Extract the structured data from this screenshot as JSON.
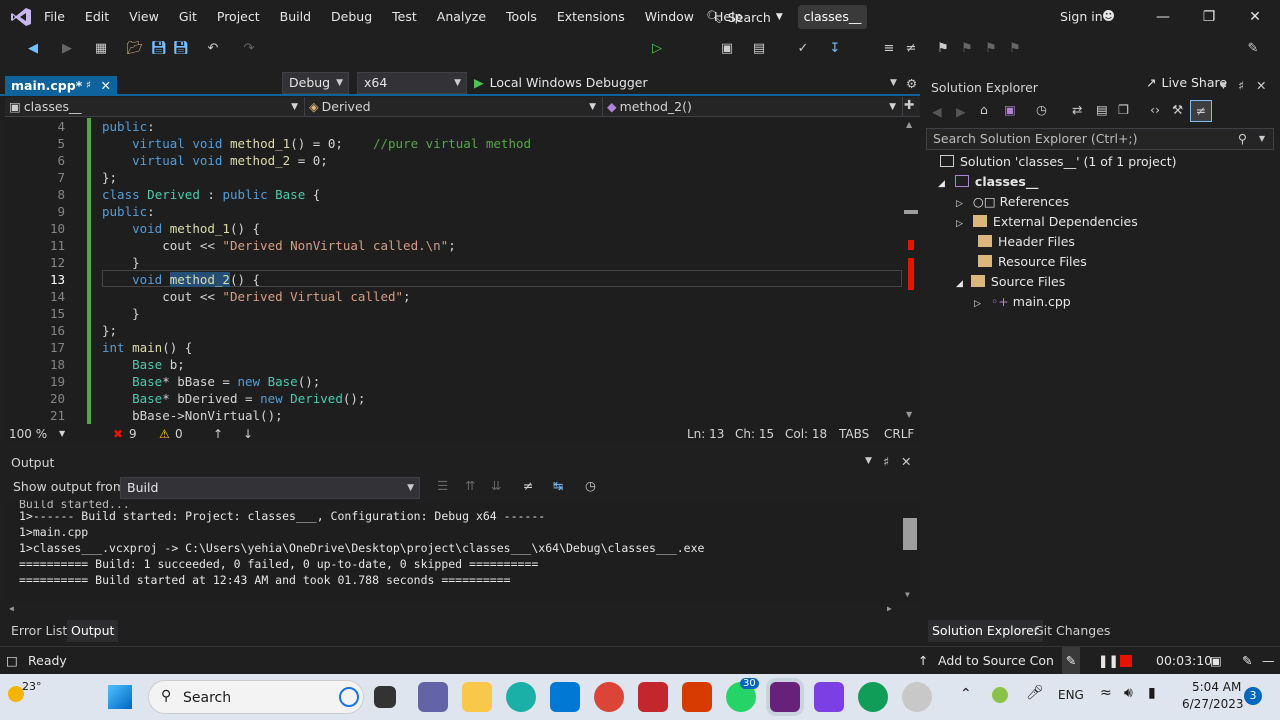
{
  "menubar": {
    "items": [
      "File",
      "Edit",
      "View",
      "Git",
      "Project",
      "Build",
      "Debug",
      "Test",
      "Analyze",
      "Tools",
      "Extensions",
      "Window",
      "Help"
    ],
    "search_label": "Search",
    "solution_name": "classes__",
    "sign_in": "Sign in"
  },
  "toolbar": {
    "config": "Debug",
    "platform": "x64",
    "debugger": "Local Windows Debugger",
    "live_share": "Live Share"
  },
  "editor": {
    "tab_label": "main.cpp*",
    "nav": {
      "project": "classes__",
      "class": "Derived",
      "member": "method_2()"
    },
    "line_numbers": [
      "4",
      "5",
      "6",
      "7",
      "8",
      "9",
      "10",
      "11",
      "12",
      "13",
      "14",
      "15",
      "16",
      "17",
      "18",
      "19",
      "20",
      "21"
    ],
    "current_line_index": 9,
    "status": {
      "zoom": "100 %",
      "errors": "9",
      "warnings": "0",
      "ln": "Ln: 13",
      "ch": "Ch: 15",
      "col": "Col: 18",
      "tabs": "TABS",
      "eol": "CRLF"
    }
  },
  "output": {
    "title": "Output",
    "show_from_label": "Show output from:",
    "source": "Build",
    "lines": [
      "Build started...",
      "1>------ Build started: Project: classes___, Configuration: Debug x64 ------",
      "1>main.cpp",
      "1>classes___.vcxproj -> C:\\Users\\yehia\\OneDrive\\Desktop\\project\\classes___\\x64\\Debug\\classes___.exe",
      "========== Build: 1 succeeded, 0 failed, 0 up-to-date, 0 skipped ==========",
      "========== Build started at 12:43 AM and took 01.788 seconds =========="
    ],
    "tabs": [
      "Error List",
      "Output"
    ]
  },
  "solution_explorer": {
    "title": "Solution Explorer",
    "search_placeholder": "Search Solution Explorer (Ctrl+;)",
    "solution": "Solution 'classes__' (1 of 1 project)",
    "project": "classes__",
    "nodes": [
      "References",
      "External Dependencies",
      "Header Files",
      "Resource Files",
      "Source Files",
      "main.cpp"
    ],
    "tabs": [
      "Solution Explorer",
      "Git Changes"
    ]
  },
  "statusbar": {
    "ready": "Ready",
    "source_control": "Add to Source Contro",
    "timer": "00:03:10"
  },
  "taskbar": {
    "weather": "23°",
    "search": "Search",
    "lang": "ENG",
    "time": "5:04 AM",
    "date": "6/27/2023",
    "badge_whatsapp": "30",
    "notification_count": "3"
  }
}
